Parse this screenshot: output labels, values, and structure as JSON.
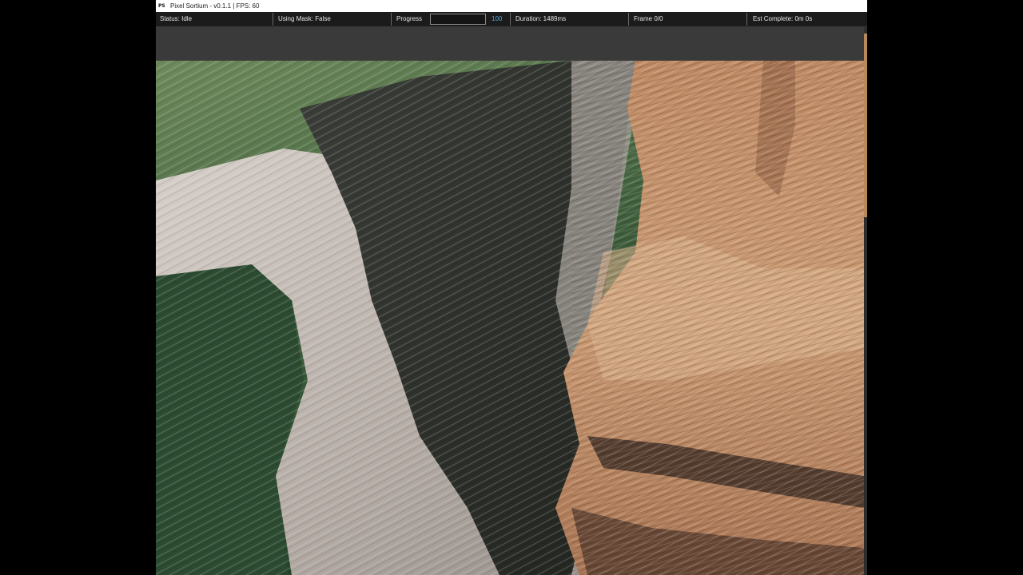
{
  "window": {
    "logo": "PS",
    "title": "Pixel Sortium - v0.1.1 | FPS: 60"
  },
  "status_bar": {
    "status": "Status: Idle",
    "mask": "Using Mask: False",
    "progress_label": "Progress",
    "progress_value": "100",
    "progress_fraction": 0,
    "duration": "Duration: 1489ms",
    "frame": "Frame 0/0",
    "estimate": "Est Complete: 0m 0s"
  },
  "canvas": {
    "description_icon": "pixel-sorted-image",
    "palette": {
      "green_dark": "#2b4a2e",
      "green": "#4c6d44",
      "grey_light": "#cfc6c0",
      "grey_mid": "#8f8a85",
      "dark": "#2f302c",
      "tan": "#c4916a",
      "tan_light": "#d4a881",
      "brown_dark": "#5b4030"
    }
  }
}
